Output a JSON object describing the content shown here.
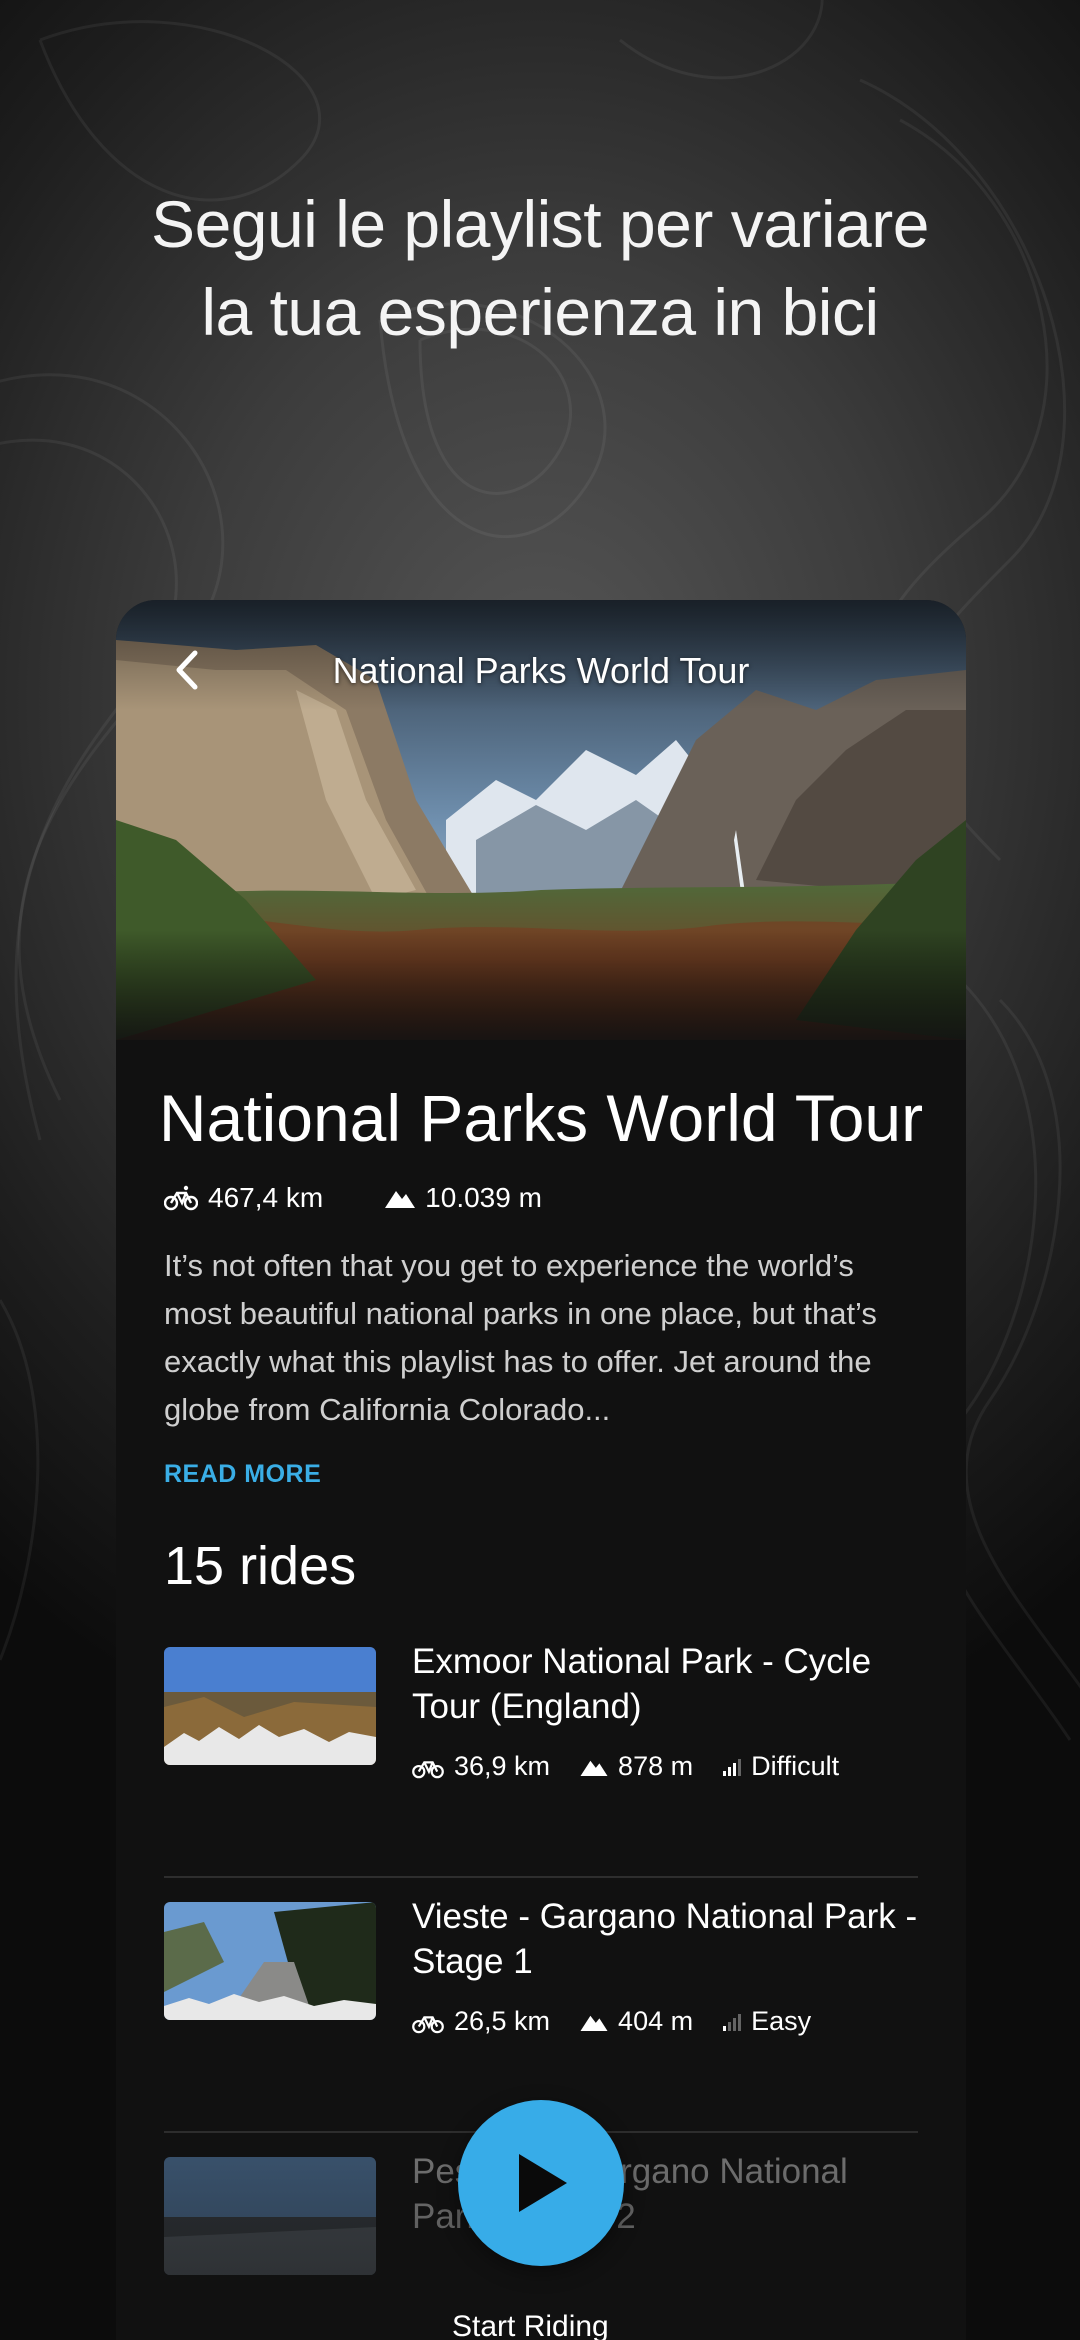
{
  "headline": {
    "line1": "Segui le playlist per variare",
    "line2": "la tua esperienza in bici"
  },
  "header": {
    "title": "National Parks World Tour",
    "back_icon": "chevron-left-icon"
  },
  "playlist": {
    "title": "National Parks World Tour",
    "distance": "467,4 km",
    "elevation": "10.039 m",
    "description": "It’s not often that you get to experience the world’s most beautiful national parks in one place, but that’s exactly what this playlist has to offer. Jet around the globe from California Colorado...",
    "read_more": "READ MORE",
    "rides_count": "15 rides"
  },
  "rides": [
    {
      "title": "Exmoor National Park - Cycle Tour (England)",
      "distance": "36,9 km",
      "elevation": "878 m",
      "difficulty": "Difficult"
    },
    {
      "title": "Vieste - Gargano National Park - Stage 1",
      "distance": "26,5 km",
      "elevation": "404 m",
      "difficulty": "Easy"
    },
    {
      "title": "Peschici - Gargano National Park - Stage 2",
      "distance": "",
      "elevation": "",
      "difficulty": ""
    }
  ],
  "play_button": {
    "icon": "play-icon",
    "label": "Start Riding"
  },
  "colors": {
    "accent": "#3aaee6",
    "play": "#37ace8",
    "card": "#111111"
  }
}
